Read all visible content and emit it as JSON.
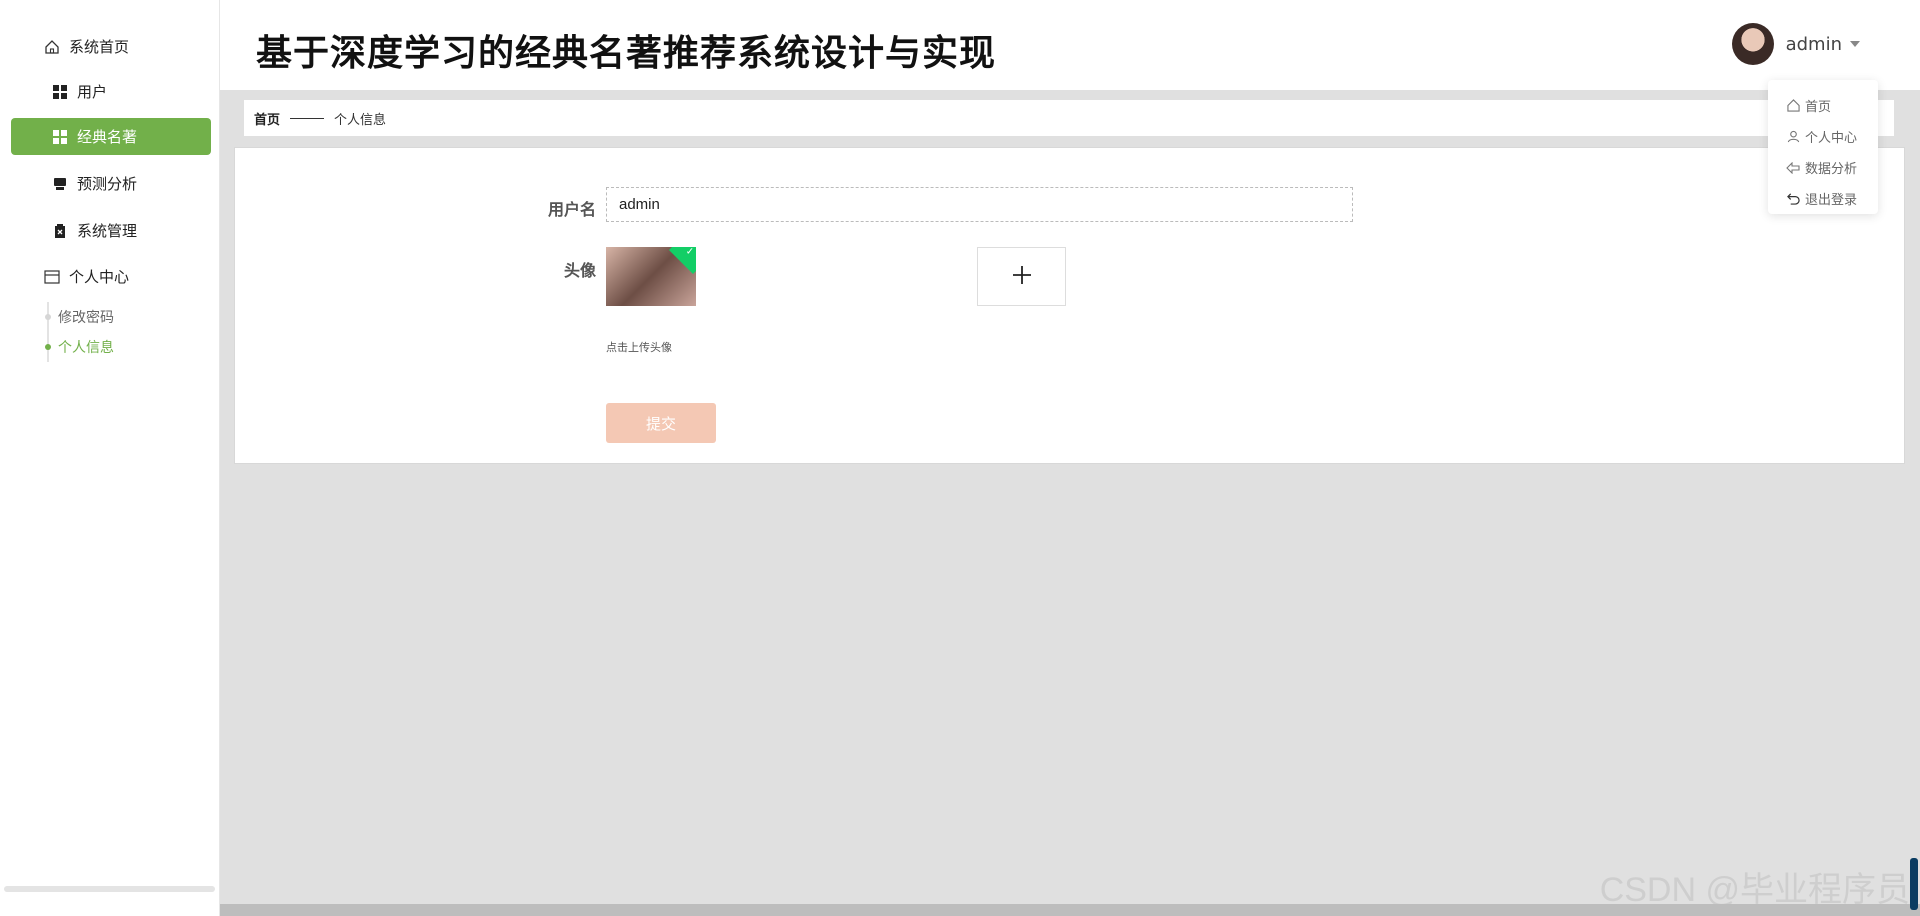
{
  "sidebar": {
    "items": [
      {
        "label": "系统首页",
        "icon": "home-icon"
      },
      {
        "label": "用户",
        "icon": "grid-icon"
      },
      {
        "label": "经典名著",
        "icon": "grid-icon",
        "active": true
      },
      {
        "label": "预测分析",
        "icon": "chart-icon"
      },
      {
        "label": "系统管理",
        "icon": "clipboard-icon"
      },
      {
        "label": "个人中心",
        "icon": "card-icon"
      }
    ],
    "sub_items": [
      {
        "label": "修改密码"
      },
      {
        "label": "个人信息",
        "active": true
      }
    ]
  },
  "header": {
    "title": "基于深度学习的经典名著推荐系统设计与实现",
    "user_name": "admin"
  },
  "dropdown": {
    "items": [
      {
        "label": "首页",
        "icon": "home-icon"
      },
      {
        "label": "个人中心",
        "icon": "user-icon"
      },
      {
        "label": "数据分析",
        "icon": "arrow-left-icon"
      },
      {
        "label": "退出登录",
        "icon": "undo-icon"
      }
    ]
  },
  "breadcrumb": {
    "home": "首页",
    "current": "个人信息"
  },
  "form": {
    "username_label": "用户名",
    "username_value": "admin",
    "avatar_label": "头像",
    "upload_hint": "点击上传头像",
    "submit_label": "提交"
  },
  "watermark": "CSDN @毕业程序员",
  "colors": {
    "accent": "#72b04a",
    "submit": "#f4c8b4",
    "success_badge": "#13ce66"
  }
}
